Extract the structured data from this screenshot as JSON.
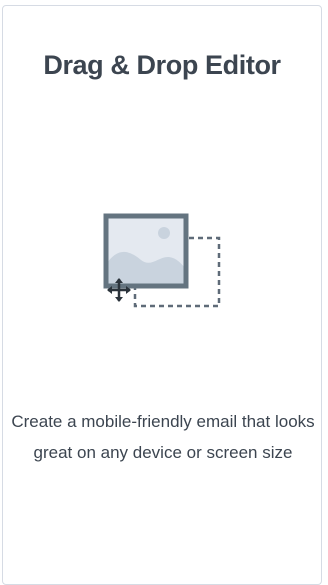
{
  "card": {
    "title": "Drag & Drop Editor",
    "icon": "drag-and-drop-image-icon",
    "description": "Create a mobile-friendly email that looks great on any device or screen size"
  },
  "colors": {
    "border": "#d6dbe4",
    "text": "#3c4550",
    "icon_frame": "#647480",
    "icon_fill": "#e4e9f0",
    "icon_mountain": "#c9d3de",
    "icon_dash": "#5f6b78"
  }
}
